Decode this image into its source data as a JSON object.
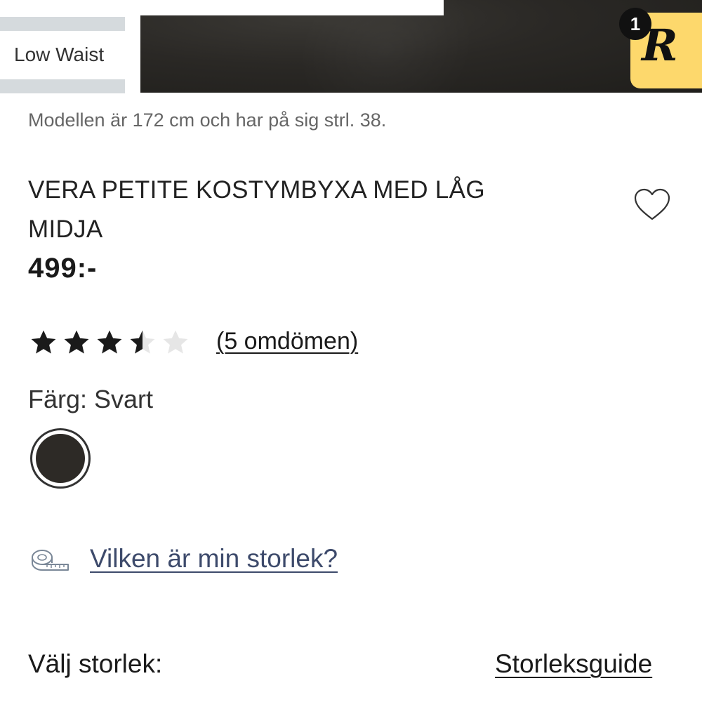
{
  "hero": {
    "tag_text": "",
    "badge_label": "Low Waist",
    "notification_count": "1",
    "r_logo": "R"
  },
  "product": {
    "model_info": "Modellen är 172 cm och har på sig strl. 38.",
    "title": "VERA PETITE KOSTYMBYXA MED LÅG MIDJA",
    "price": "499:-",
    "rating": 3.5,
    "rating_max": 5,
    "reviews_link": "(5 omdömen)",
    "color_label": "Färg: Svart",
    "color_swatch": "#2d2a26",
    "size_help_link": "Vilken är min storlek?",
    "choose_size_label": "Välj storlek:",
    "size_guide_link": "Storleksguide"
  },
  "icons": {
    "wishlist": "heart-icon",
    "measure": "measuring-tape-icon",
    "star": "star-icon"
  },
  "colors": {
    "badge_yellow": "#fdd86c",
    "link_blue": "#3d4a6b",
    "stripe_grey": "#d5dadd"
  }
}
